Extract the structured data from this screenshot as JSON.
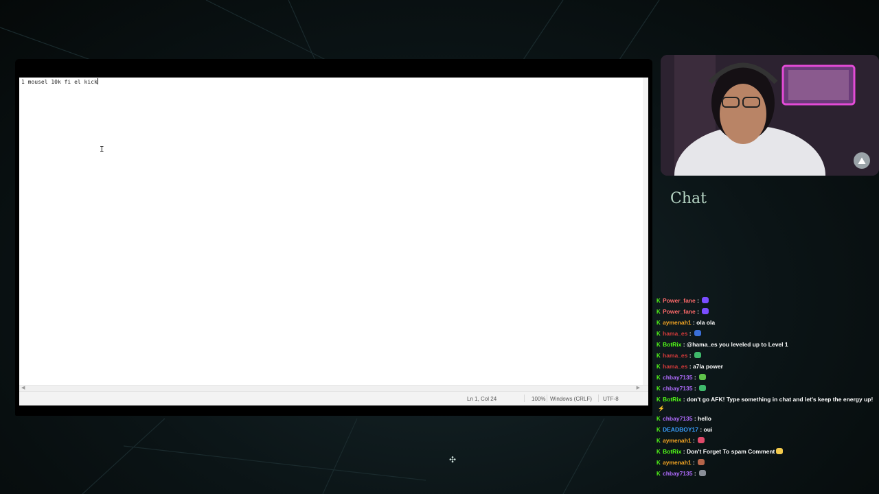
{
  "editor": {
    "text": "1 mousel 10k fi el kick",
    "status": {
      "position": "Ln 1, Col 24",
      "zoom": "100%",
      "line_ending": "Windows (CRLF)",
      "encoding": "UTF-8"
    }
  },
  "chat": {
    "title": "Chat",
    "messages": [
      {
        "user": "Power_fane",
        "sep": " : ",
        "text": "",
        "user_color": "#ff6b6b",
        "emote_color": "#7a4dff"
      },
      {
        "user": "Power_fane",
        "sep": " : ",
        "text": "",
        "user_color": "#ff6b6b",
        "emote_color": "#7a4dff"
      },
      {
        "user": "aymenah1",
        "sep": " : ",
        "text": "ola ola",
        "user_color": "#f5a623"
      },
      {
        "user": "hama_es",
        "sep": " : ",
        "text": "",
        "user_color": "#d63b3b",
        "emote_color": "#3a6fd8"
      },
      {
        "user": "BotRix",
        "sep": " : ",
        "text": "@hama_es you leveled up to Level 1",
        "user_color": "#53fc18"
      },
      {
        "user": "hama_es",
        "sep": " : ",
        "text": "",
        "user_color": "#d63b3b",
        "emote_color": "#3fb96b"
      },
      {
        "user": "hama_es",
        "sep": " : ",
        "text": "a7la power",
        "user_color": "#d63b3b"
      },
      {
        "user": "chbay7135",
        "sep": " : ",
        "text": "",
        "user_color": "#b06cff",
        "emote_color": "#5fc24a"
      },
      {
        "user": "chbay7135",
        "sep": " : ",
        "text": "",
        "user_color": "#b06cff",
        "emote_color": "#3fb96b"
      },
      {
        "user": "BotRix",
        "sep": " : ",
        "text": "don't go AFK! Type something in chat and let's keep the energy up!",
        "user_color": "#53fc18"
      },
      {
        "user": "chbay7135",
        "sep": " : ",
        "text": "hello",
        "user_color": "#b06cff"
      },
      {
        "user": "DEADBOY17",
        "sep": " : ",
        "text": "oui",
        "user_color": "#3aa0ff"
      },
      {
        "user": "aymenah1",
        "sep": " : ",
        "text": "",
        "user_color": "#f5a623",
        "emote_color": "#e04a6a"
      },
      {
        "user": "BotRix",
        "sep": " : ",
        "text": "Don't Forget To spam Comment",
        "user_color": "#53fc18",
        "emote_color": "#f2c94c"
      },
      {
        "user": "aymenah1",
        "sep": " : ",
        "text": "",
        "user_color": "#f5a623",
        "emote_color": "#b5654a"
      },
      {
        "user": "chbay7135",
        "sep": " : ",
        "text": "",
        "user_color": "#b06cff",
        "emote_color": "#8a8f98"
      }
    ]
  },
  "colors": {
    "kick_green": "#53fc18",
    "chat_title": "#b7d6c5"
  }
}
